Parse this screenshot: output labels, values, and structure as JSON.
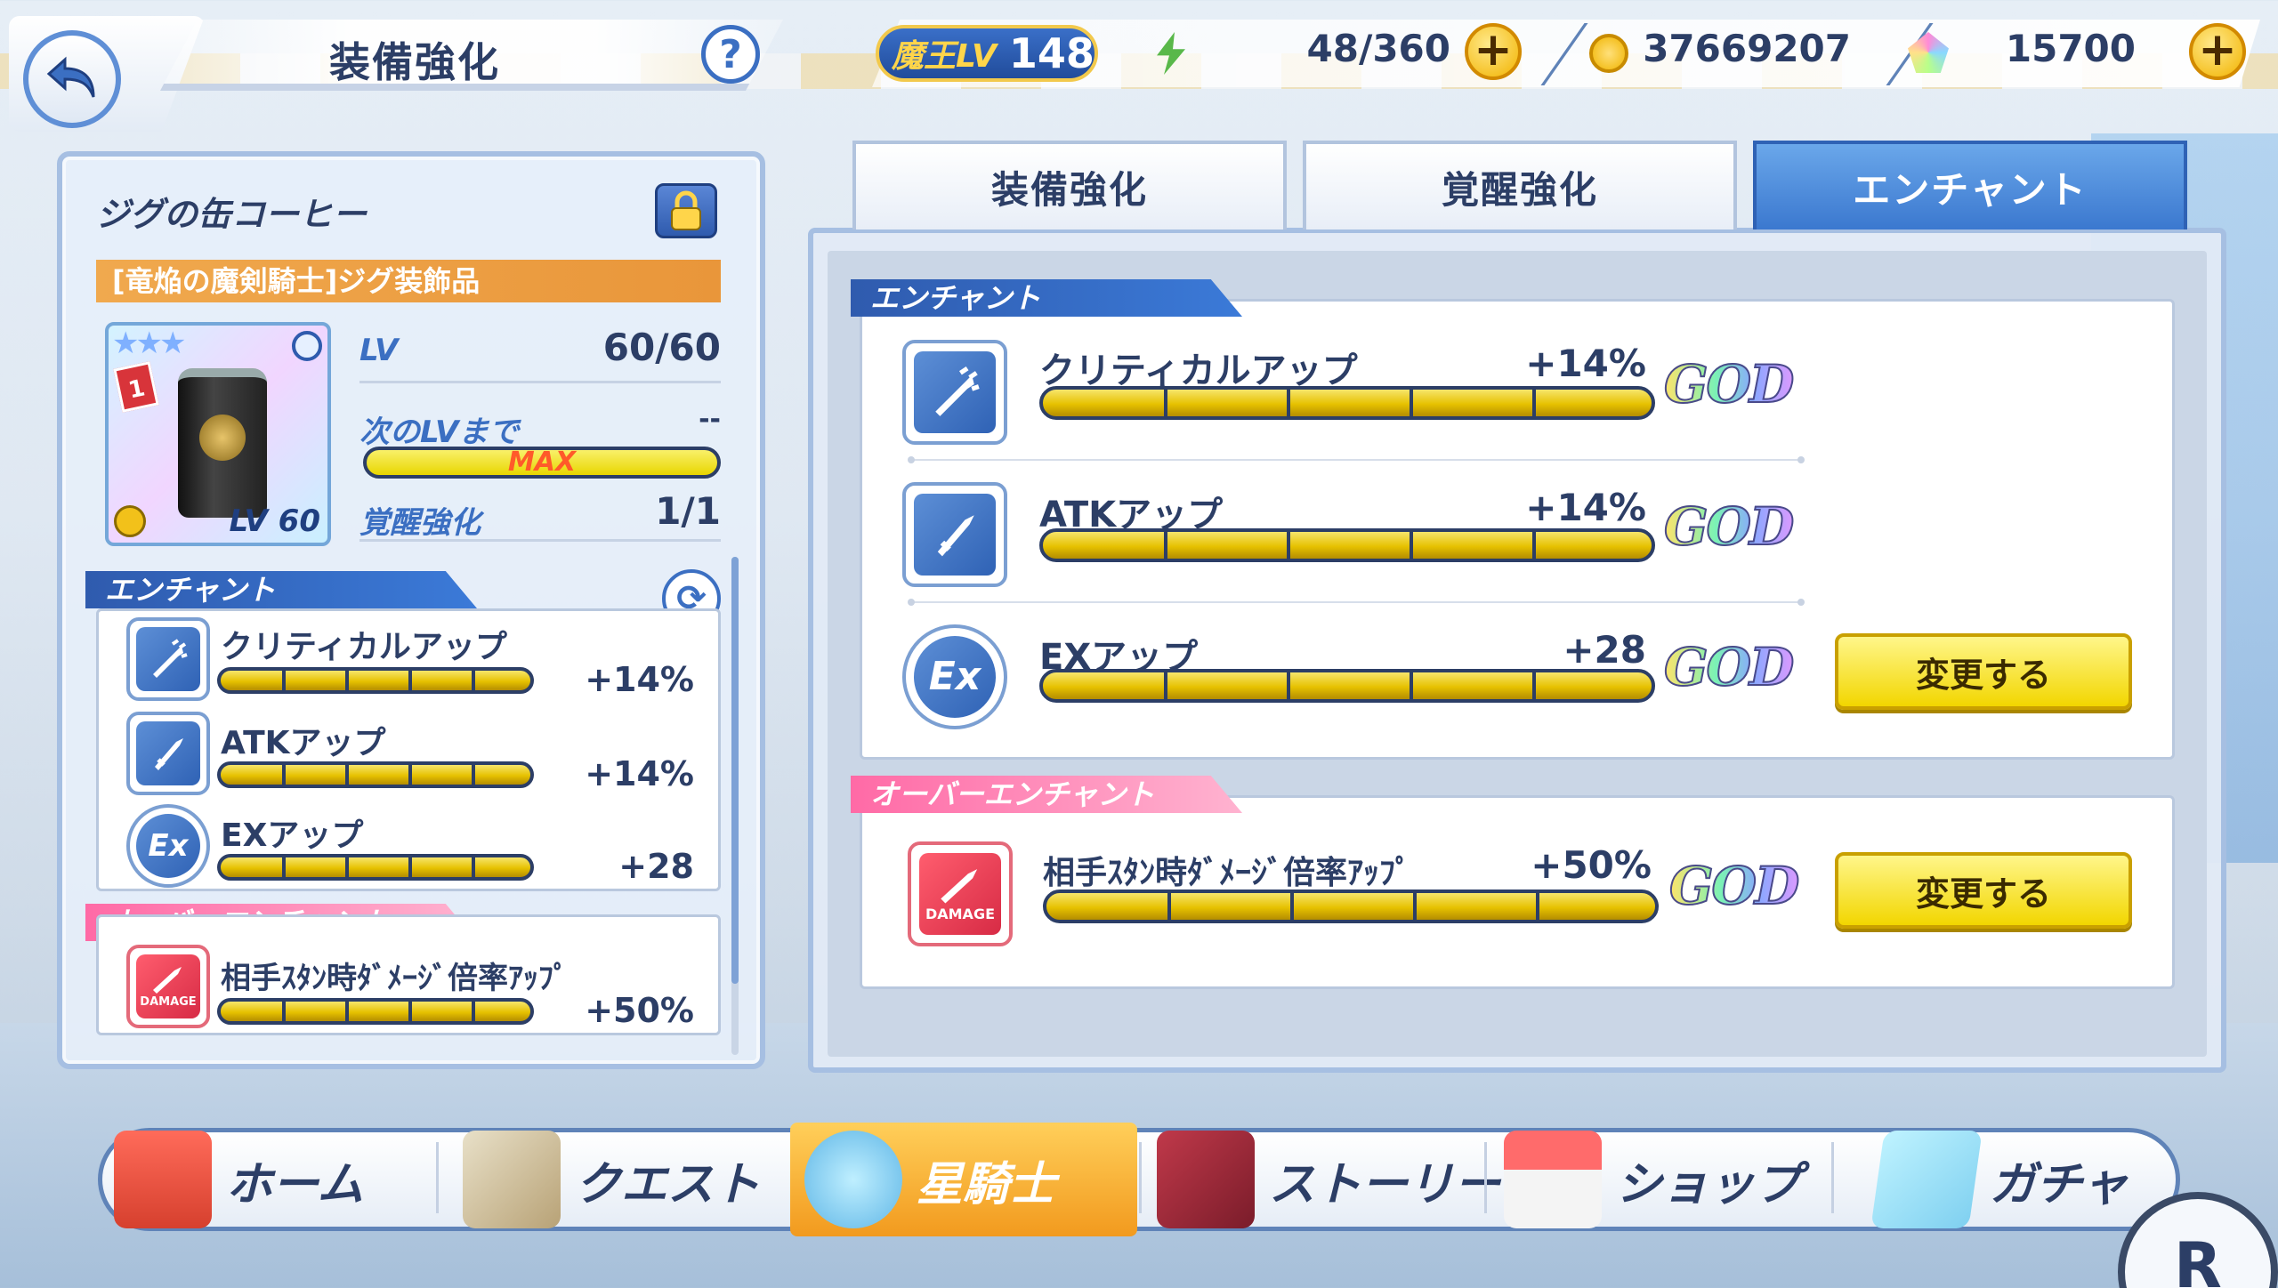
{
  "header": {
    "title": "装備強化",
    "help": "?",
    "maou_label": "魔王LV",
    "maou_level": "148",
    "stamina": "48/360",
    "coins": "37669207",
    "gems": "15700",
    "plus": "+"
  },
  "item": {
    "name": "ジグの缶コーヒー",
    "subtitle": "[竜焔の魔剣騎士]ジグ装飾品",
    "card_lv": "LV 60",
    "rank": "1",
    "lv_label": "LV",
    "lv_value": "60/60",
    "next_label": "次のLVまで",
    "next_value": "--",
    "max_label": "MAX",
    "awaken_label": "覚醒強化",
    "awaken_value": "1/1"
  },
  "left_enchant": {
    "header": "エンチャント",
    "items": [
      {
        "name": "クリティカルアップ",
        "value": "+14%"
      },
      {
        "name": "ATKアップ",
        "value": "+14%"
      },
      {
        "name": "EXアップ",
        "value": "+28"
      }
    ],
    "over_header": "オーバーエンチャント",
    "over_items": [
      {
        "name": "相手ｽﾀﾝ時ﾀﾞﾒｰｼﾞ倍率ｱｯﾌﾟ",
        "value": "+50%"
      }
    ]
  },
  "tabs": [
    {
      "label": "装備強化"
    },
    {
      "label": "覚醒強化"
    },
    {
      "label": "エンチャント"
    }
  ],
  "right_enchant": {
    "header": "エンチャント",
    "items": [
      {
        "name": "クリティカルアップ",
        "value": "+14%",
        "grade": "GOD"
      },
      {
        "name": "ATKアップ",
        "value": "+14%",
        "grade": "GOD"
      },
      {
        "name": "EXアップ",
        "value": "+28",
        "grade": "GOD"
      }
    ],
    "change_label": "変更する",
    "over_header": "オーバーエンチャント",
    "over_items": [
      {
        "name": "相手ｽﾀﾝ時ﾀﾞﾒｰｼﾞ倍率ｱｯﾌﾟ",
        "value": "+50%",
        "grade": "GOD"
      }
    ],
    "over_change_label": "変更する"
  },
  "icons": {
    "ex": "Ex",
    "damage": "DAMAGE"
  },
  "nav": [
    {
      "label": "ホーム"
    },
    {
      "label": "クエスト"
    },
    {
      "label": "星騎士"
    },
    {
      "label": "ストーリー"
    },
    {
      "label": "ショップ"
    },
    {
      "label": "ガチャ"
    }
  ],
  "corner_letter": "R",
  "colors": {
    "accent": "#3b6fc2",
    "gold": "#f2c94c",
    "tab_active": "#3b78cf",
    "over_pink": "#ff6aa6"
  }
}
